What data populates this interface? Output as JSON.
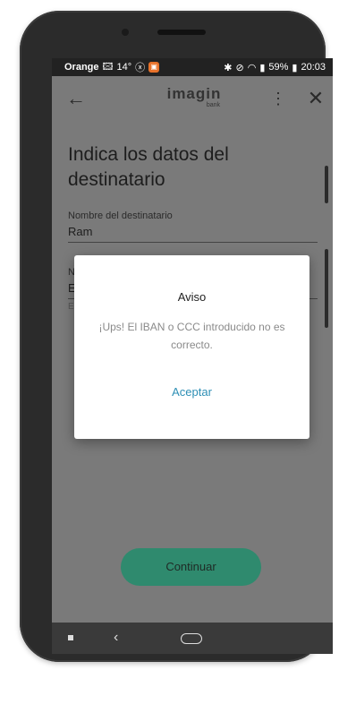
{
  "statusbar": {
    "carrier": "Orange",
    "temperature": "14°",
    "battery": "59%",
    "time": "20:03"
  },
  "appbar": {
    "logo_word": "imagin",
    "logo_sub": "bank"
  },
  "page": {
    "title": "Indica los datos del destinatario"
  },
  "fields": [
    {
      "label": "Nombre del destinatario",
      "value": "Ram"
    },
    {
      "label": "N",
      "value": "E",
      "hint": "E"
    }
  ],
  "dialog": {
    "title": "Aviso",
    "message": "¡Ups! El IBAN o CCC introducido no es correcto.",
    "action": "Aceptar"
  },
  "continue_button": "Continuar",
  "colors": {
    "accent": "#2e8fb5",
    "primary_button": "#2f8a6e",
    "dim_background": "#7a7a7a"
  }
}
